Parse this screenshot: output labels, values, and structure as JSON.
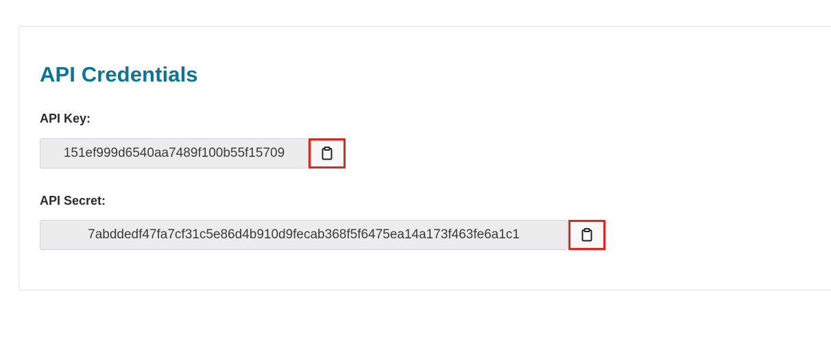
{
  "card": {
    "title": "API Credentials",
    "api_key": {
      "label": "API Key:",
      "value": "151ef999d6540aa7489f100b55f15709",
      "copy_icon": "clipboard-icon"
    },
    "api_secret": {
      "label": "API Secret:",
      "value": "7abddedf47fa7cf31c5e86d4b910d9fecab368f5f6475ea14a173f463fe6a1c1",
      "copy_icon": "clipboard-icon"
    }
  },
  "colors": {
    "title": "#0a7597",
    "highlight": "#e8241a",
    "field_bg": "#ececec"
  }
}
